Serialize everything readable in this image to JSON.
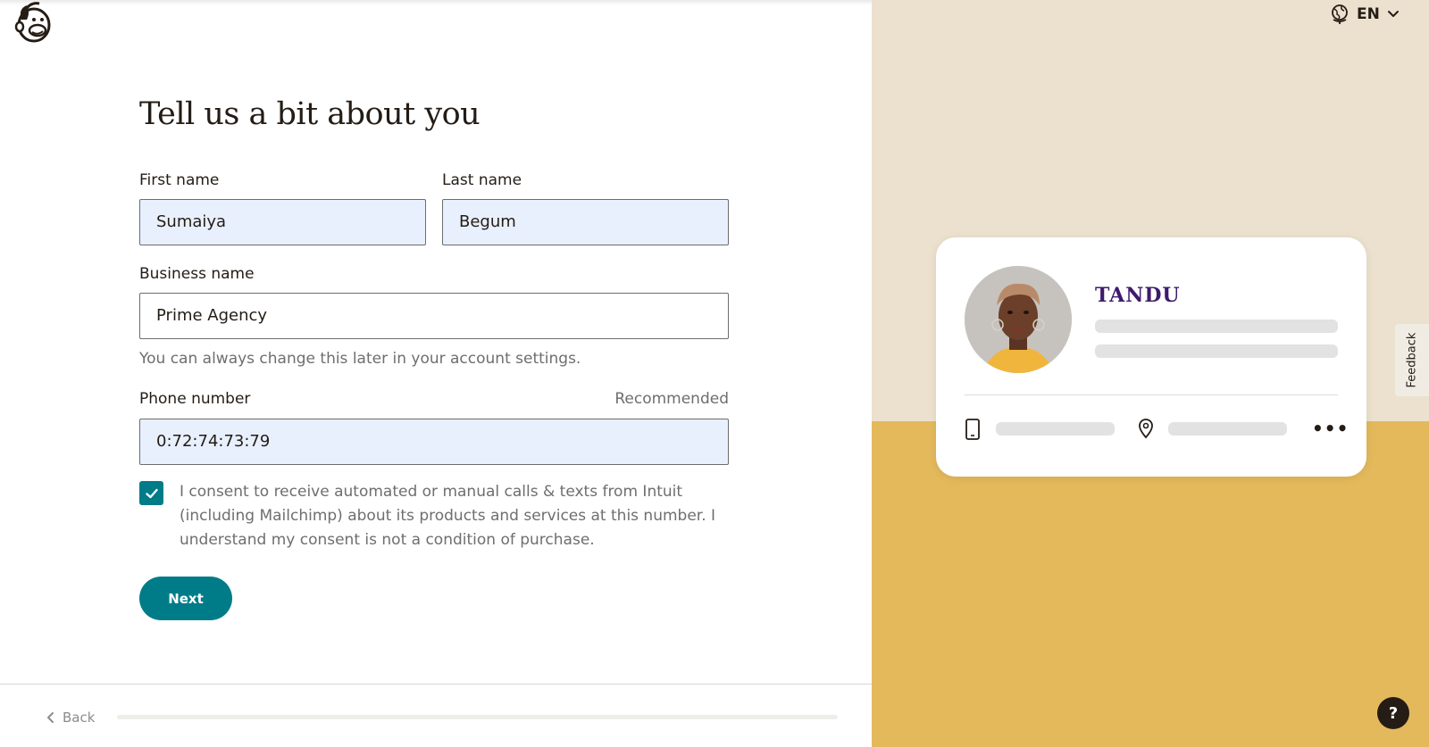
{
  "header": {
    "logo_icon": "mailchimp-freddie-logo"
  },
  "form": {
    "title": "Tell us a bit about you",
    "first_name": {
      "label": "First name",
      "value": "Sumaiya"
    },
    "last_name": {
      "label": "Last name",
      "value": "Begum"
    },
    "business_name": {
      "label": "Business name",
      "value": "Prime Agency",
      "helper": "You can always change this later in your account settings."
    },
    "phone_number": {
      "label": "Phone number",
      "badge": "Recommended",
      "value": "0:72:74:73:79"
    },
    "consent": {
      "checked": true,
      "text": "I consent to receive automated or manual calls & texts from Intuit (including Mailchimp) about its products and services at this number. I understand my consent is not a condition of purchase."
    },
    "next_label": "Next"
  },
  "footer": {
    "back_label": "Back",
    "progress": 0
  },
  "language": {
    "code": "EN",
    "icon": "globe-icon"
  },
  "preview_card": {
    "brand": "TANDU",
    "icons": [
      "mobile-phone-icon",
      "location-pin-icon",
      "more-dots-icon"
    ],
    "more_label": "•••"
  },
  "feedback_label": "Feedback",
  "help_label": "?",
  "colors": {
    "accent": "#007c89",
    "autofill_bg": "#e8f0fe",
    "panel_top": "#ebe1ce",
    "panel_bottom": "#e4b95c",
    "brand_purple": "#3e1a6e"
  }
}
